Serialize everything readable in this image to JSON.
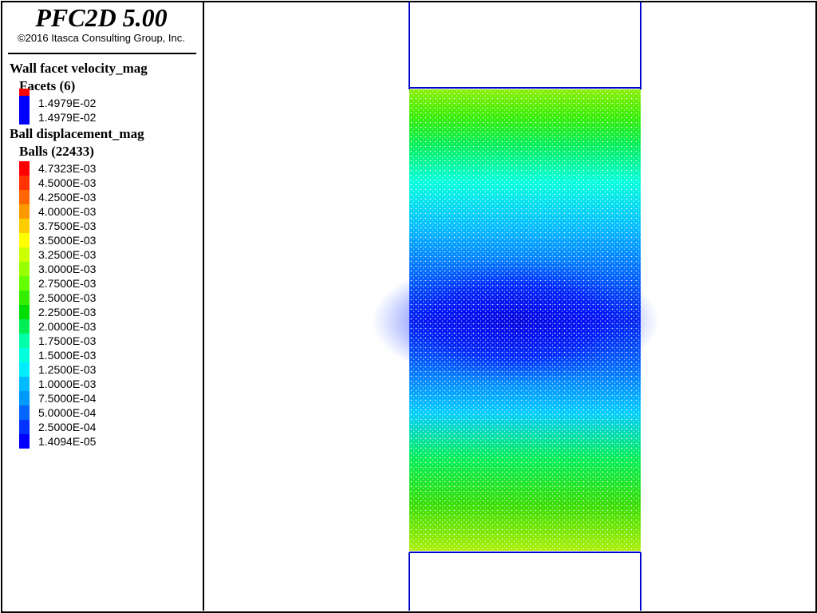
{
  "app": {
    "title": "PFC2D 5.00",
    "copyright": "©2016 Itasca Consulting Group, Inc."
  },
  "legend": {
    "wall": {
      "title": "Wall facet velocity_mag",
      "group": "Facets (6)",
      "entries": [
        {
          "label": "1.4979E-02",
          "color": "#0000ff"
        },
        {
          "label": "1.4979E-02",
          "color": "#0000ff"
        }
      ],
      "top_color": "#ff0000"
    },
    "ball": {
      "title": "Ball displacement_mag",
      "group": "Balls (22433)",
      "entries": [
        {
          "label": "4.7323E-03",
          "color": "#ff0000"
        },
        {
          "label": "4.5000E-03",
          "color": "#ff3300"
        },
        {
          "label": "4.2500E-03",
          "color": "#ff6600"
        },
        {
          "label": "4.0000E-03",
          "color": "#ff9900"
        },
        {
          "label": "3.7500E-03",
          "color": "#ffcc00"
        },
        {
          "label": "3.5000E-03",
          "color": "#ffff00"
        },
        {
          "label": "3.2500E-03",
          "color": "#ccff00"
        },
        {
          "label": "3.0000E-03",
          "color": "#99ff00"
        },
        {
          "label": "2.7500E-03",
          "color": "#66ff00"
        },
        {
          "label": "2.5000E-03",
          "color": "#33ee00"
        },
        {
          "label": "2.2500E-03",
          "color": "#00dd00"
        },
        {
          "label": "2.0000E-03",
          "color": "#00ee55"
        },
        {
          "label": "1.7500E-03",
          "color": "#00ffaa"
        },
        {
          "label": "1.5000E-03",
          "color": "#00ffdd"
        },
        {
          "label": "1.2500E-03",
          "color": "#00eeff"
        },
        {
          "label": "1.0000E-03",
          "color": "#00bbff"
        },
        {
          "label": "7.5000E-04",
          "color": "#0099ff"
        },
        {
          "label": "5.0000E-04",
          "color": "#0066ff"
        },
        {
          "label": "2.5000E-04",
          "color": "#0033ff"
        },
        {
          "label": "1.4094E-05",
          "color": "#0000ff"
        }
      ]
    }
  },
  "colors": {
    "wall": "#0000cc",
    "platen_edge": "#00aa00",
    "background": "#ffffff"
  }
}
